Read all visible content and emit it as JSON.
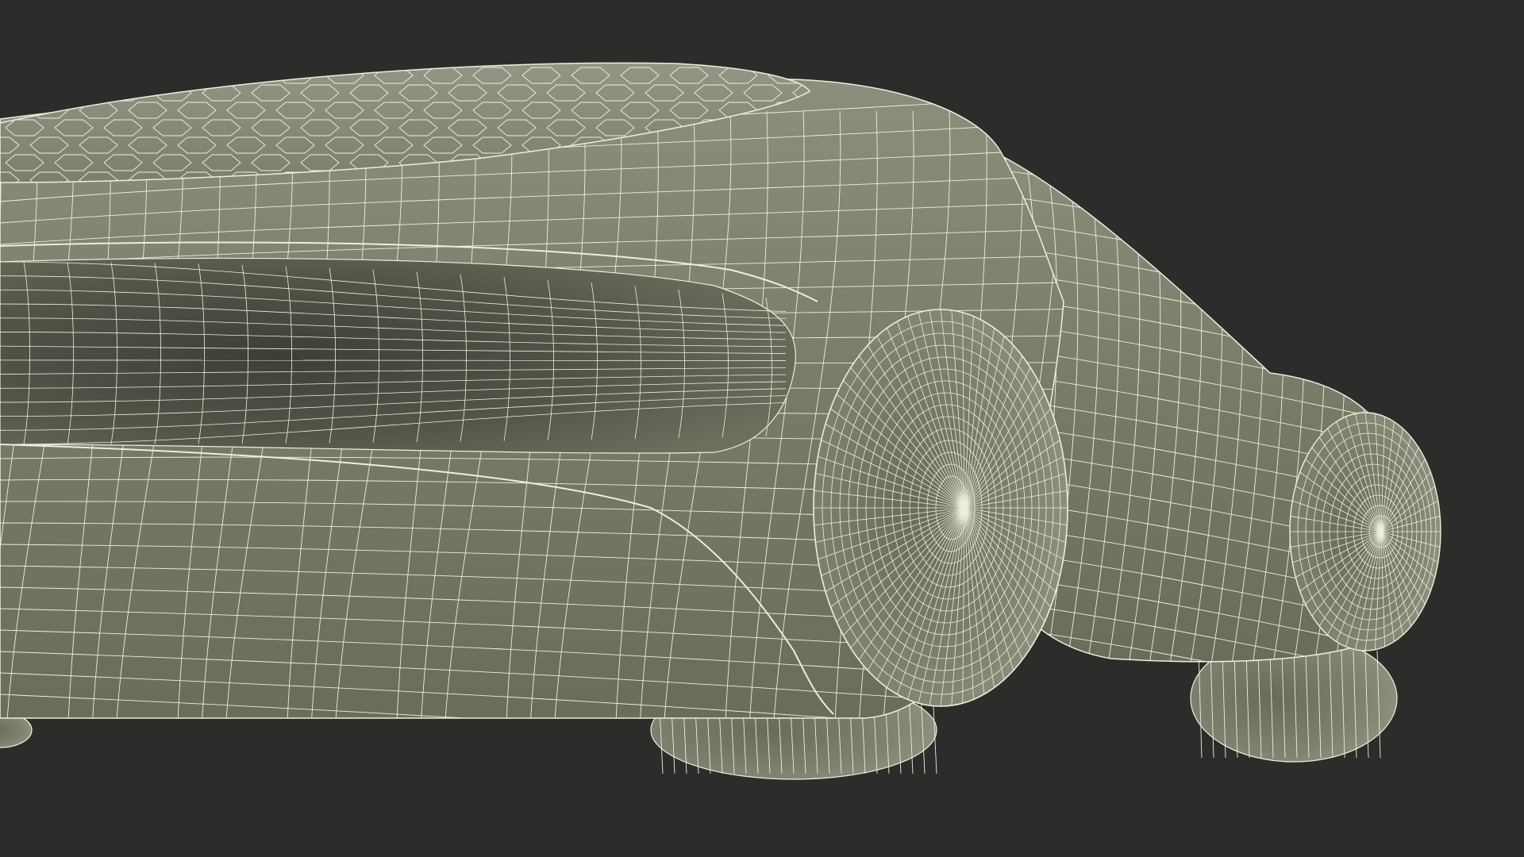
{
  "scene": {
    "subject": "car-wireframe",
    "colors": {
      "background": "#2c2c2b",
      "body_base": "#7b7b6a",
      "body_light": "#8f8f7e",
      "body_dark": "#5c5c50",
      "cavity": "#4a4a40",
      "wire": "#eeeede"
    }
  }
}
